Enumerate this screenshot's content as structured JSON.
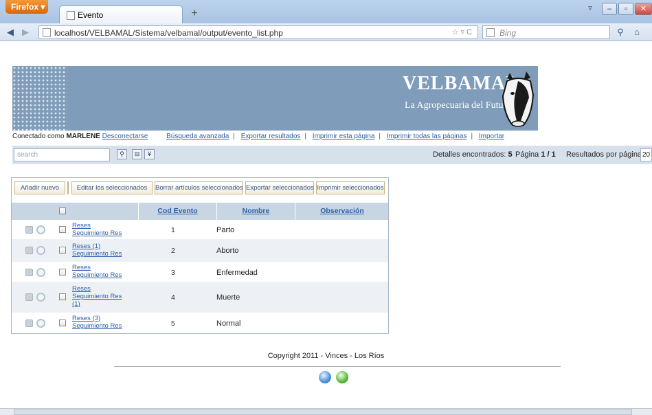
{
  "browser": {
    "menu_label": "Firefox",
    "tab_title": "Evento",
    "url": "localhost/VELBAMAL/Sistema/velbamal/output/evento_list.php",
    "search_engine": "Bing"
  },
  "header": {
    "brand": "VELBAMAL",
    "slogan": "La Agropecuaria del Futuro."
  },
  "userbar": {
    "connected_prefix": "Conectado como",
    "username": "MARLENE",
    "logout": "Desconectarse",
    "links": [
      "Búsqueda avanzada",
      "Exportar resultados",
      "Imprimir esta página",
      "Imprimir todas las páginas",
      "Importar"
    ]
  },
  "toolbar": {
    "search_placeholder": "search",
    "found_label": "Detalles encontrados:",
    "found_value": "5",
    "page_label": "Página",
    "page_value": "1 / 1",
    "per_page_label": "Resultados por página:",
    "per_page_value": "20"
  },
  "actions": [
    "Añadir nuevo",
    "Editar los seleccionados",
    "Borrar artículos seleccionados",
    "Exportar seleccionados",
    "Imprimir seleccionados"
  ],
  "table": {
    "columns": [
      "Cod Evento",
      "Nombre",
      "Observación"
    ],
    "rows": [
      {
        "links": [
          "Reses",
          "Seguimiento Res"
        ],
        "cod": "1",
        "nombre": "Parto"
      },
      {
        "links": [
          "Reses (1)",
          "Seguimiento Res"
        ],
        "cod": "2",
        "nombre": "Aborto"
      },
      {
        "links": [
          "Reses",
          "Seguimiento Res"
        ],
        "cod": "3",
        "nombre": "Enfermedad"
      },
      {
        "links": [
          "Reses",
          "Seguimiento Res",
          "(1)"
        ],
        "cod": "4",
        "nombre": "Muerte"
      },
      {
        "links": [
          "Reses (3)",
          "Seguimiento Res"
        ],
        "cod": "5",
        "nombre": "Normal"
      }
    ]
  },
  "footer": {
    "copyright": "Copyright 2011 - Vinces - Los Ríos"
  },
  "colors": {
    "banner": "#7f9dba",
    "toolbar": "#d7e1ec",
    "link": "#2b5ea8",
    "header_row": "#c8d6e4"
  }
}
